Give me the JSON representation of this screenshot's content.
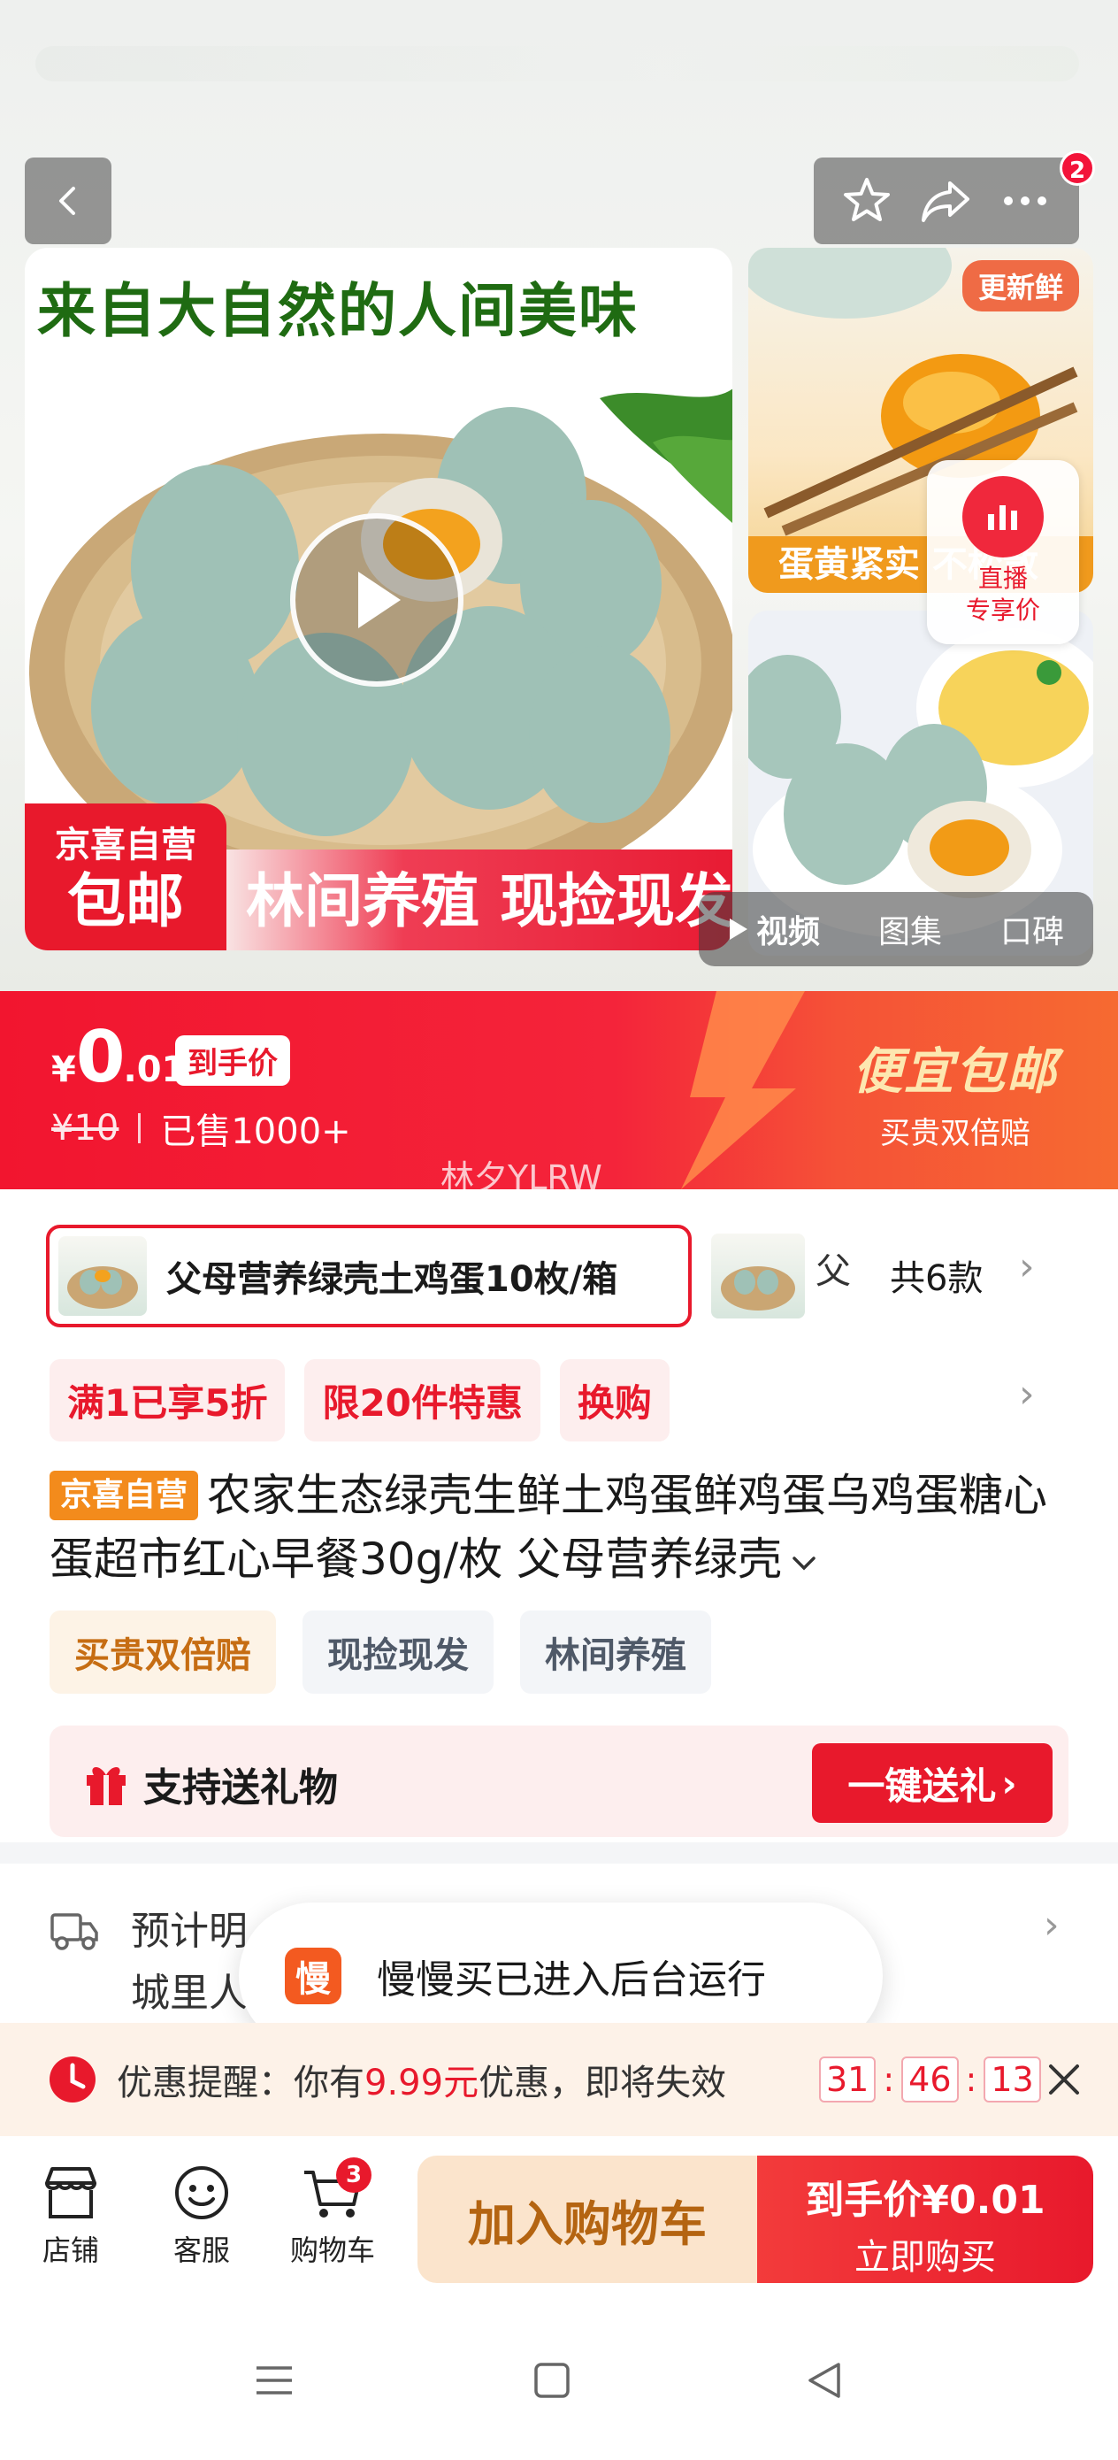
{
  "header": {
    "back_icon": "chevron-left-icon",
    "notification_count": "2",
    "icons": [
      "star-icon",
      "share-icon",
      "more-icon"
    ]
  },
  "media": {
    "tagline": "来自大自然的人间美味",
    "badge_line1": "京喜自营",
    "badge_line2": "包邮",
    "slogan": "林间养殖 现捡现发",
    "thumb1_tag": "更新鲜",
    "thumb1_tip": "蛋黄紧实 不松散",
    "live_line1": "直播",
    "live_line2": "专享价",
    "tabs": [
      "视频",
      "图集",
      "口碑"
    ]
  },
  "price": {
    "symbol": "¥",
    "integer": "0",
    "decimal": ".01",
    "tag": "到手价",
    "original": "¥10",
    "sold": "已售1000+",
    "promo_big": "便宜包邮",
    "promo_small": "买贵双倍赔",
    "faint_text": "林夕YLRW"
  },
  "variants": {
    "selected": "父母营养绿壳土鸡蛋10枚/箱",
    "next_partial": "父",
    "count": "共6款"
  },
  "promos": [
    "满1已享5折",
    "限20件特惠",
    "换购"
  ],
  "product": {
    "self_tag": "京喜自营",
    "title": "农家生态绿壳生鲜土鸡蛋鲜鸡蛋乌鸡蛋糖心蛋超市红心早餐30g/枚 父母营养绿壳"
  },
  "chips": [
    "买贵双倍赔",
    "现捡现发",
    "林间养殖"
  ],
  "gift": {
    "label": "支持送礼物",
    "button": "一键送礼"
  },
  "delivery": {
    "line1": "预计明",
    "line2": "城里人"
  },
  "toast": {
    "icon_text": "慢",
    "text": "慢慢买已进入后台运行"
  },
  "reminder": {
    "prefix": "优惠提醒：你有",
    "amount": "9.99元",
    "suffix": "优惠，即将失效",
    "hours": "31",
    "minutes": "46",
    "seconds": "13"
  },
  "bottom_bar": {
    "store": "店铺",
    "service": "客服",
    "cart": "购物车",
    "cart_count": "3",
    "add_to_cart": "加入购物车",
    "buy_line1": "到手价¥0.01",
    "buy_line2": "立即购买"
  },
  "colors": {
    "accent": "#e8192c",
    "orange": "#f38b1c",
    "gift_bg": "#fdeeee"
  }
}
